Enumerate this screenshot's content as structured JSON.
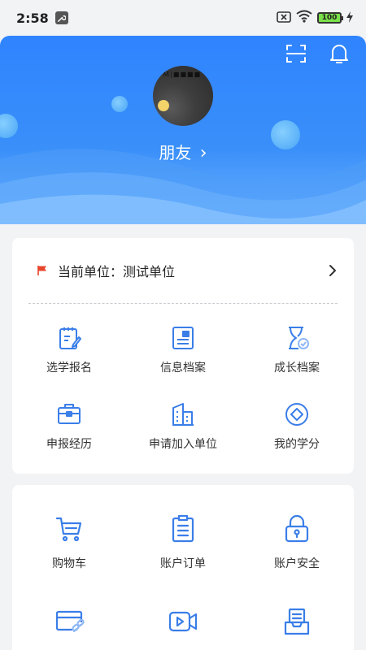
{
  "status": {
    "time": "2:58",
    "battery": "100"
  },
  "profile": {
    "name": "朋友",
    "chevron": "›",
    "avatar_text": "M|■■■■"
  },
  "unit": {
    "label": "当前单位：测试单位"
  },
  "menu1": [
    {
      "label": "选学报名",
      "icon": "clipboard-edit-icon"
    },
    {
      "label": "信息档案",
      "icon": "document-card-icon"
    },
    {
      "label": "成长档案",
      "icon": "hourglass-check-icon"
    },
    {
      "label": "申报经历",
      "icon": "briefcase-icon"
    },
    {
      "label": "申请加入单位",
      "icon": "building-icon"
    },
    {
      "label": "我的学分",
      "icon": "credit-diamond-icon"
    }
  ],
  "menu2": [
    {
      "label": "购物车",
      "icon": "cart-icon"
    },
    {
      "label": "账户订单",
      "icon": "order-list-icon"
    },
    {
      "label": "账户安全",
      "icon": "lock-icon"
    },
    {
      "label": "",
      "icon": "card-link-icon"
    },
    {
      "label": "",
      "icon": "video-icon"
    },
    {
      "label": "",
      "icon": "inbox-icon"
    }
  ],
  "colors": {
    "accent": "#3a7ee8",
    "header": "#2f84ff",
    "flag": "#e8452c"
  }
}
